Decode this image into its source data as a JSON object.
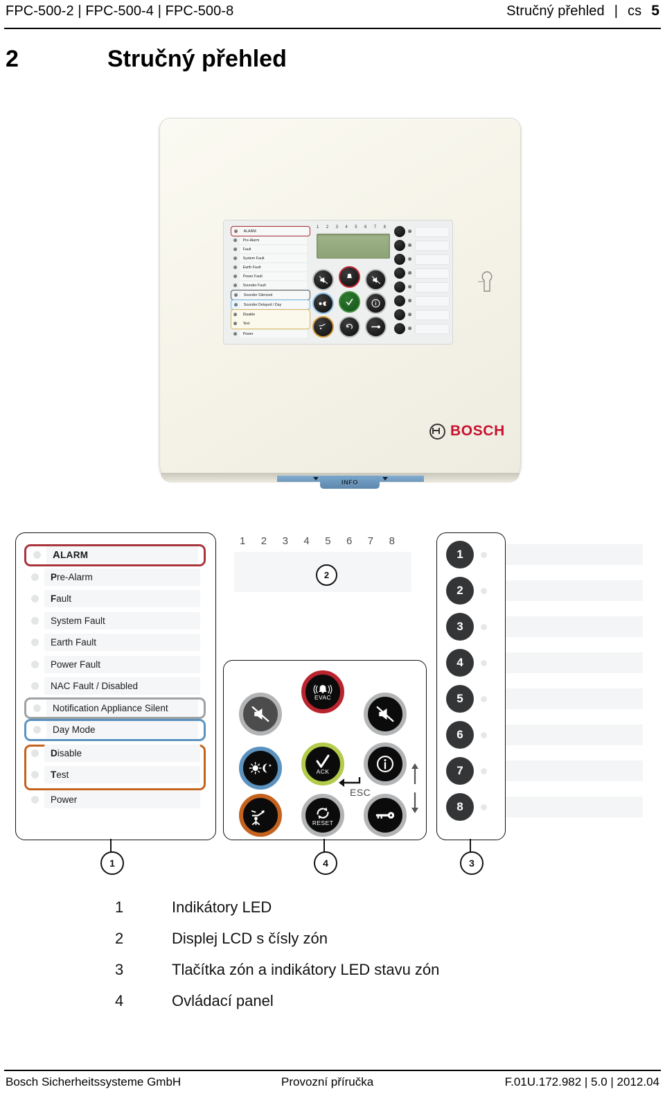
{
  "header": {
    "left_models": [
      "FPC-500-2",
      "FPC-500-4",
      "FPC-500-8"
    ],
    "left_text": "FPC-500-2 | FPC-500-4 | FPC-500-8",
    "right_title": "Stručný přehled",
    "right_lang": "cs",
    "page_number": "5",
    "separator": "|"
  },
  "chapter": {
    "number": "2",
    "title": "Stručný přehled"
  },
  "photo": {
    "brand": "BOSCH",
    "info_tab_label": "INFO",
    "faceplate_led_labels": [
      "ALARM",
      "Pre-Alarm",
      "Fault",
      "System Fault",
      "Earth Fault",
      "Power Fault",
      "Sounder Fault",
      "Sounder Silenced",
      "Sounder Delayed / Day",
      "Disable",
      "Test",
      "Power"
    ],
    "faceplate_zone_numbers": [
      "1",
      "2",
      "3",
      "4",
      "5",
      "6",
      "7",
      "8"
    ],
    "key_icons": [
      "sounder-off-icon",
      "evac-bell-icon",
      "sounder-silence-icon",
      "day-night-icon",
      "ack-check-icon",
      "info-icon",
      "fire-brigade-icon",
      "reset-icon",
      "key-icon"
    ]
  },
  "diagram": {
    "led_rows": [
      {
        "label": "ALARM",
        "style": "caps",
        "border": "red"
      },
      {
        "label": "Pre-Alarm",
        "bold_prefix": "P",
        "border": "none"
      },
      {
        "label": "Fault",
        "bold_prefix": "F",
        "border": "none"
      },
      {
        "label": "System Fault",
        "border": "none"
      },
      {
        "label": "Earth Fault",
        "border": "none"
      },
      {
        "label": "Power Fault",
        "border": "none"
      },
      {
        "label": "NAC Fault / Disabled",
        "border": "none"
      },
      {
        "label": "Notification Appliance Silent",
        "border": "grey"
      },
      {
        "label": "Day Mode",
        "border": "blue"
      },
      {
        "label": "Disable",
        "bold_prefix": "D",
        "border": "orange-group"
      },
      {
        "label": "Test",
        "bold_prefix": "T",
        "border": "orange-group"
      },
      {
        "label": "Power",
        "border": "none"
      }
    ],
    "lcd_zone_numbers": [
      "1",
      "2",
      "3",
      "4",
      "5",
      "6",
      "7",
      "8"
    ],
    "keypad": {
      "buttons": [
        {
          "id": "sounder-off",
          "icon": "sounder-off-icon",
          "caption": "",
          "ring": "grey-dark"
        },
        {
          "id": "evac",
          "icon": "evac-bell-icon",
          "caption": "EVAC",
          "ring": "red"
        },
        {
          "id": "sounder-silence",
          "icon": "sounder-silence-icon",
          "caption": "",
          "ring": "grey"
        },
        {
          "id": "day-night",
          "icon": "day-night-icon",
          "caption": "",
          "ring": "blue"
        },
        {
          "id": "ack",
          "icon": "check-icon",
          "caption": "ACK",
          "ring": "green"
        },
        {
          "id": "info",
          "icon": "info-icon",
          "caption": "",
          "ring": "grey"
        },
        {
          "id": "fire-brigade",
          "icon": "fire-brigade-icon",
          "caption": "",
          "ring": "orange"
        },
        {
          "id": "reset",
          "icon": "reset-icon",
          "caption": "RESET",
          "ring": "grey"
        },
        {
          "id": "key",
          "icon": "key-icon",
          "caption": "",
          "ring": "grey"
        }
      ],
      "esc_label": "ESC",
      "enter_icon": "enter-arrow-icon",
      "scroll_icon": "up-down-arrow-icon"
    },
    "zone_buttons": [
      "1",
      "2",
      "3",
      "4",
      "5",
      "6",
      "7",
      "8"
    ],
    "callouts": [
      {
        "number": "1",
        "target": "led-box"
      },
      {
        "number": "2",
        "target": "lcd-display"
      },
      {
        "number": "3",
        "target": "zone-box"
      },
      {
        "number": "4",
        "target": "keypad-box"
      }
    ],
    "colors": {
      "alarm_border": "#a8343c",
      "notification_border": "#9ea2a4",
      "day_mode_border": "#5b92bf",
      "disable_test_border": "#c4621f",
      "evac_ring": "#b9242f",
      "ack_ring": "#b2cb4a",
      "brand_red": "#c8102e"
    }
  },
  "legend": [
    {
      "num": "1",
      "text": "Indikátory LED"
    },
    {
      "num": "2",
      "text": "Displej LCD s čísly zón"
    },
    {
      "num": "3",
      "text": "Tlačítka zón a indikátory LED stavu zón"
    },
    {
      "num": "4",
      "text": "Ovládací panel"
    }
  ],
  "footer": {
    "left": "Bosch Sicherheitssysteme GmbH",
    "middle": "Provozní příručka",
    "right": "F.01U.172.982 | 5.0 | 2012.04"
  }
}
